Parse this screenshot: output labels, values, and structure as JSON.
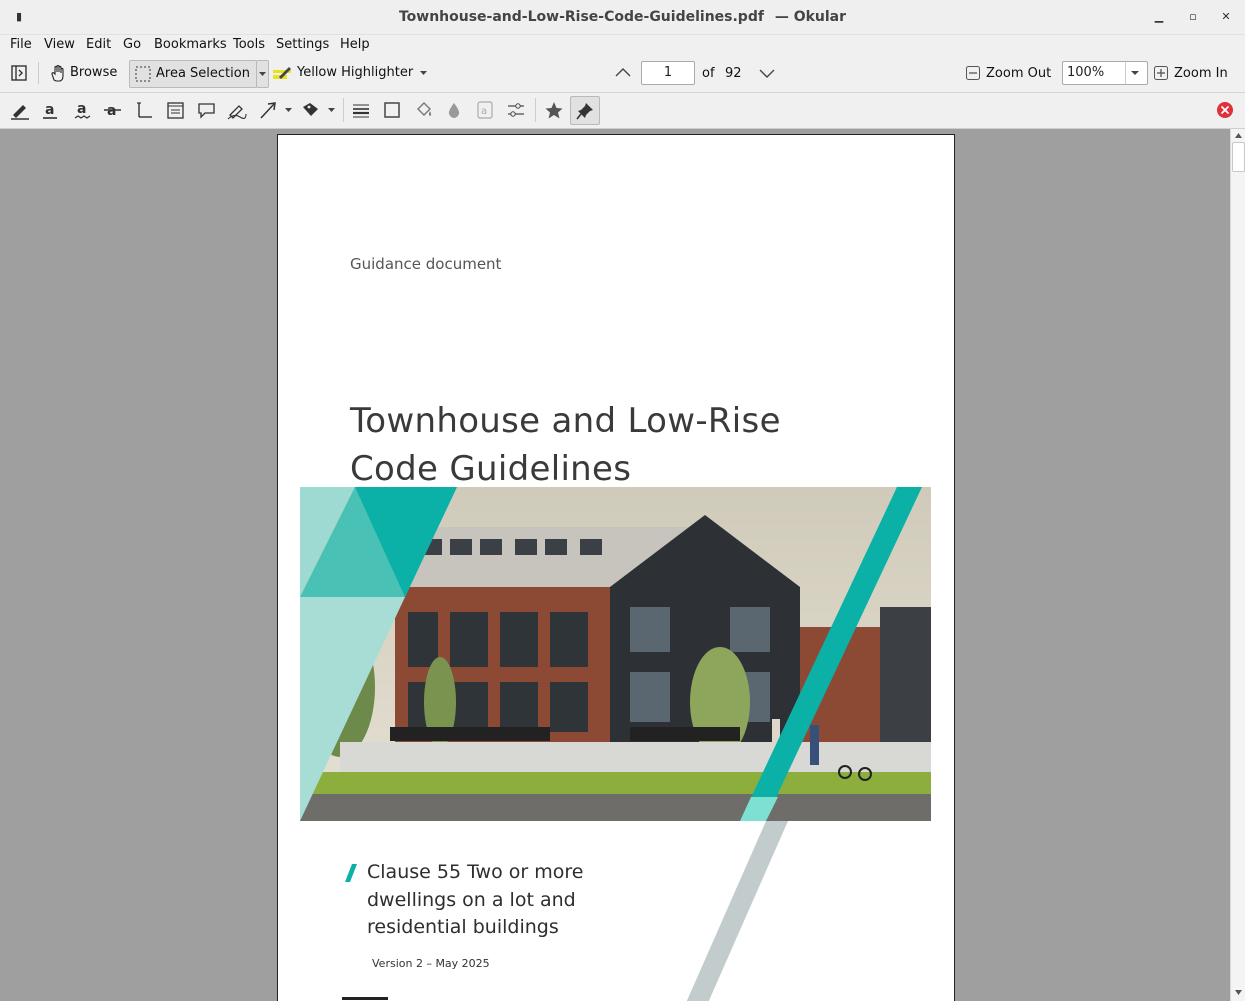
{
  "window": {
    "filename": "Townhouse-and-Low-Rise-Code-Guidelines.pdf",
    "separator": "—",
    "app": "Okular"
  },
  "menu": [
    "File",
    "View",
    "Edit",
    "Go",
    "Bookmarks",
    "Tools",
    "Settings",
    "Help"
  ],
  "toolbar": {
    "browse_label": "Browse",
    "area_selection_label": "Area Selection",
    "highlighter_label": "Yellow Highlighter",
    "page_current": "1",
    "page_of": "of",
    "page_total": "92",
    "zoom_out_label": "Zoom Out",
    "zoom_value": "100%",
    "zoom_in_label": "Zoom In"
  },
  "annotation_tools": [
    "highlighter-icon",
    "underline-icon",
    "squiggle-icon",
    "strikeout-icon",
    "typewriter-icon",
    "inline-note-icon",
    "popup-note-icon",
    "freehand-line-icon",
    "arrow-icon",
    "stamp-icon",
    "line-width-icon",
    "rectangle-icon",
    "fill-color-icon",
    "opacity-icon",
    "font-icon",
    "annotation-settings-icon",
    "favorite-icon",
    "pin-icon"
  ],
  "document": {
    "doc_type": "Guidance document",
    "title_line1": "Townhouse and Low-Rise",
    "title_line2": "Code Guidelines",
    "subtitle_line1": "Clause 55 Two or more",
    "subtitle_line2": "dwellings on a lot and",
    "subtitle_line3": "residential buildings",
    "version": "Version 2 – May 2025"
  },
  "colors": {
    "teal": "#0bb1a6",
    "teal_light": "#9fdad2",
    "grey_stripe": "#c2cccc",
    "close_red": "#e0303a"
  }
}
